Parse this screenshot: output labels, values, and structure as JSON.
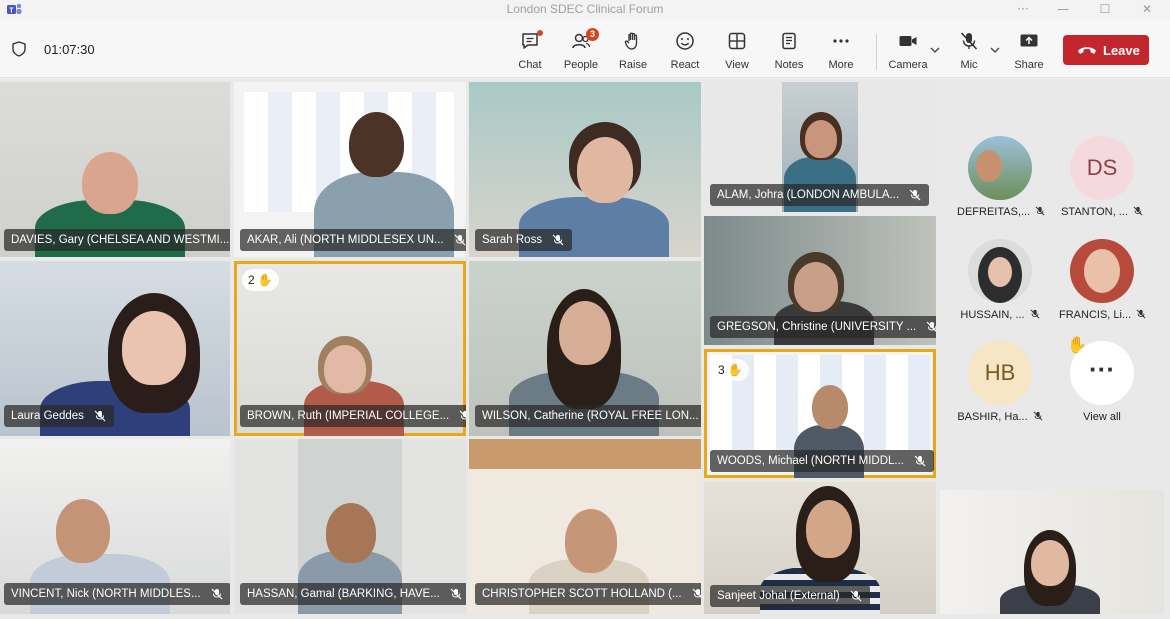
{
  "window": {
    "title": "London SDEC Clinical Forum",
    "controls": [
      "···",
      "—",
      "☐",
      "✕"
    ]
  },
  "toolbar": {
    "timer": "01:07:30",
    "chat_label": "Chat",
    "people_label": "People",
    "people_badge": "3",
    "raise_label": "Raise",
    "react_label": "React",
    "view_label": "View",
    "notes_label": "Notes",
    "more_label": "More",
    "camera_label": "Camera",
    "mic_label": "Mic",
    "share_label": "Share",
    "leave_label": "Leave",
    "accent_color": "#c4262e"
  },
  "tiles": [
    {
      "name": "DAVIES, Gary (CHELSEA AND WESTMI..."
    },
    {
      "name": "AKAR, Ali (NORTH MIDDLESEX UN..."
    },
    {
      "name": "Sarah Ross"
    },
    {
      "name": "ALAM, Johra (LONDON AMBULA..."
    },
    {
      "name": "Laura Geddes"
    },
    {
      "name": "BROWN, Ruth (IMPERIAL COLLEGE...",
      "hand_order": "2"
    },
    {
      "name": "WILSON, Catherine (ROYAL FREE LON..."
    },
    {
      "name": "GREGSON, Christine (UNIVERSITY ..."
    },
    {
      "name": "WOODS, Michael (NORTH MIDDL...",
      "hand_order": "3"
    },
    {
      "name": "VINCENT, Nick (NORTH MIDDLES..."
    },
    {
      "name": "HASSAN, Gamal (BARKING, HAVE..."
    },
    {
      "name": "CHRISTOPHER SCOTT HOLLAND (..."
    },
    {
      "name": "Sanjeet Johal (External)"
    }
  ],
  "roster": [
    {
      "name": "DEFREITAS,..."
    },
    {
      "name": "STANTON, ...",
      "initials": "DS"
    },
    {
      "name": "HUSSAIN, ..."
    },
    {
      "name": "FRANCIS, Li..."
    },
    {
      "name": "BASHIR, Ha...",
      "initials": "HB"
    },
    {
      "name": "View all",
      "icon": "ellipsis-icon"
    }
  ]
}
